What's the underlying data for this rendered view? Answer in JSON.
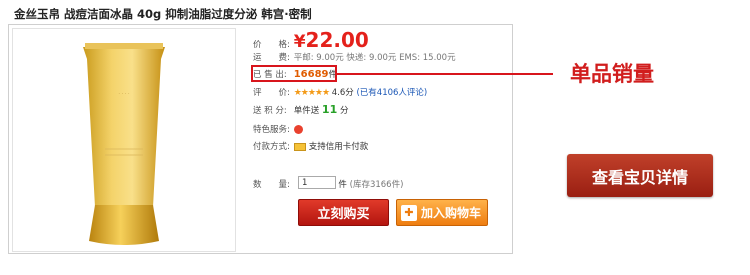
{
  "product": {
    "title": "金丝玉帛 战痘洁面冰晶 40g 抑制油脂过度分泌 韩宫·密制"
  },
  "details": {
    "price_label": "价　　格:",
    "currency": "¥",
    "price": "22.00",
    "shipping_label": "运　　费:",
    "shipping_text": "平邮: 9.00元 快递: 9.00元 EMS: 15.00元",
    "sold_label": "已 售 出:",
    "sold_count": "16689",
    "sold_unit": "件",
    "rating_label": "评　　价:",
    "rating_stars": "★★★★★",
    "rating_score": "4.6分",
    "rating_link": "(已有4106人评论)",
    "points_label": "送 积 分:",
    "points_prefix": "单件送",
    "points_value": "11",
    "points_unit": "分",
    "service_label": "特色服务:",
    "payment_label": "付款方式:",
    "payment_text": "支持信用卡付款",
    "qty_label": "数　　量:",
    "qty_value": "1",
    "qty_unit": "件",
    "stock_text": "(库存3166件)"
  },
  "actions": {
    "buy_now": "立刻购买",
    "add_to_cart": "加入购物车",
    "view_detail": "查看宝贝详情"
  },
  "annotation": {
    "callout": "单品销量"
  },
  "colors": {
    "accent_red": "#e4211b",
    "callout_red": "#d11d1d",
    "cart_orange": "#ee7d10",
    "points_green": "#28a028"
  }
}
